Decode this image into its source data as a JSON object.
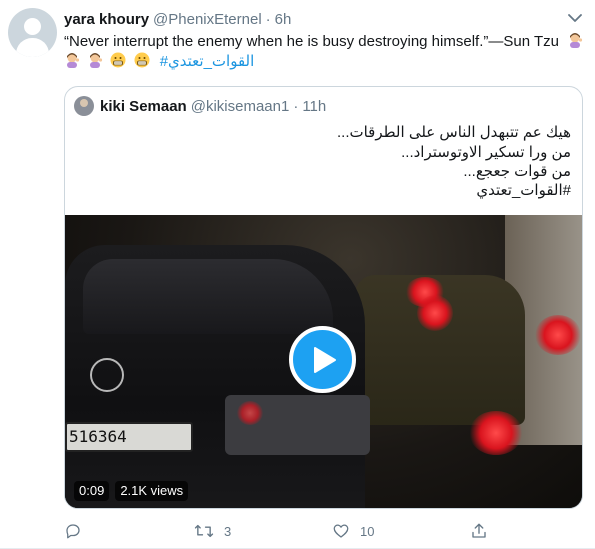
{
  "tweet": {
    "author_name": "yara khoury",
    "author_handle": "@PhenixEternel",
    "separator": "·",
    "time": "6h",
    "text_line1": "“Never interrupt the enemy when he is busy destroying himself.”—Sun Tzu",
    "hashtag": "#القوات_تعتدي",
    "emojis_line1": [
      "woman-tipping-hand-emoji"
    ],
    "emojis_line2": [
      "woman-tipping-hand-emoji",
      "woman-tipping-hand-emoji",
      "grimacing-face-emoji",
      "grimacing-face-emoji"
    ],
    "reply_count": "",
    "retweet_count": "3",
    "like_count": "10"
  },
  "quoted": {
    "author_name": "kiki Semaan",
    "author_handle": "@kikisemaan1",
    "separator": "·",
    "time": "11h",
    "lines": [
      "هيك عم تتبهدل الناس على الطرقات...",
      "من ورا تسكير الاوتوستراد...",
      "من قوات جعجع...",
      "#القوات_تعتدي"
    ],
    "video": {
      "duration": "0:09",
      "views": "2.1K views",
      "plate_text": "516364"
    }
  },
  "colors": {
    "link": "#1b95e0",
    "play": "#1da1f2",
    "muted": "#657786",
    "text": "#14171a",
    "border": "#ccd6dd"
  }
}
